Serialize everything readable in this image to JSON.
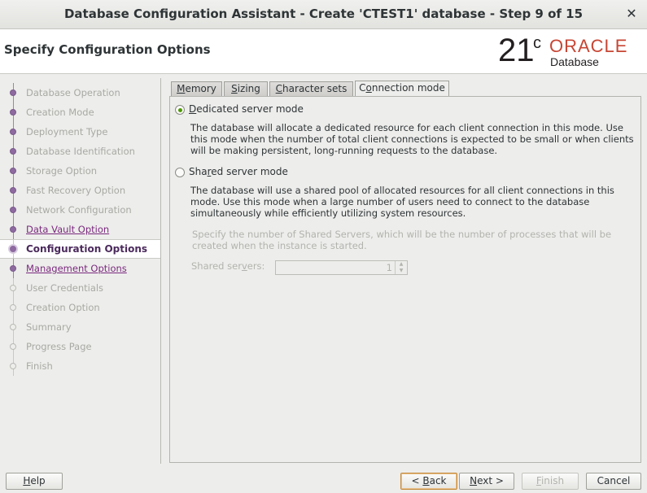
{
  "window": {
    "title": "Database Configuration Assistant - Create 'CTEST1' database - Step 9 of 15",
    "close_glyph": "✕"
  },
  "header": {
    "page_title": "Specify Configuration Options",
    "logo": {
      "version": "21",
      "superscript": "c",
      "brand": "ORACLE",
      "product": "Database"
    }
  },
  "steps": [
    {
      "label": "Database Operation",
      "state": "done"
    },
    {
      "label": "Creation Mode",
      "state": "done"
    },
    {
      "label": "Deployment Type",
      "state": "done"
    },
    {
      "label": "Database Identification",
      "state": "done"
    },
    {
      "label": "Storage Option",
      "state": "done"
    },
    {
      "label": "Fast Recovery Option",
      "state": "done"
    },
    {
      "label": "Network Configuration",
      "state": "done"
    },
    {
      "label": "Data Vault Option",
      "state": "link"
    },
    {
      "label": "Configuration Options",
      "state": "current"
    },
    {
      "label": "Management Options",
      "state": "link"
    },
    {
      "label": "User Credentials",
      "state": "pending"
    },
    {
      "label": "Creation Option",
      "state": "pending"
    },
    {
      "label": "Summary",
      "state": "pending"
    },
    {
      "label": "Progress Page",
      "state": "pending"
    },
    {
      "label": "Finish",
      "state": "pending"
    }
  ],
  "tabs": {
    "memory": {
      "mnemonic": "M",
      "rest": "emory"
    },
    "sizing": {
      "mnemonic": "S",
      "rest": "izing"
    },
    "charsets": {
      "mnemonic": "C",
      "rest": "haracter sets"
    },
    "connection": {
      "pre": "C",
      "mnemonic": "o",
      "rest": "nnection mode"
    },
    "active": "connection"
  },
  "connection_mode": {
    "dedicated": {
      "pre": "",
      "mnemonic": "D",
      "rest": "edicated server mode",
      "selected": true,
      "description": "The database will allocate a dedicated resource for each client connection in this mode. Use this mode when the number of total client connections is expected to be small or when clients will be making persistent, long-running requests to the database."
    },
    "shared": {
      "pre": "Sha",
      "mnemonic": "r",
      "rest": "ed server mode",
      "selected": false,
      "description": "The database will use a shared pool of allocated resources for all client connections in this mode.  Use this mode when a large number of users need to connect to the database simultaneously while efficiently utilizing system resources."
    },
    "shared_servers_note": "Specify the number of Shared Servers, which will be the number of processes that will be created when the instance is started.",
    "shared_servers_label": {
      "pre": "Shared ser",
      "mnemonic": "v",
      "rest": "ers:"
    },
    "shared_servers_value": "1",
    "spinner_up": "▲",
    "spinner_down": "▼"
  },
  "buttons": {
    "help": {
      "mnemonic": "H",
      "rest": "elp"
    },
    "back": {
      "pre": "< ",
      "mnemonic": "B",
      "rest": "ack"
    },
    "next": {
      "mnemonic": "N",
      "rest": "ext >"
    },
    "finish": {
      "mnemonic": "F",
      "rest": "inish"
    },
    "cancel": {
      "label": "Cancel"
    }
  }
}
